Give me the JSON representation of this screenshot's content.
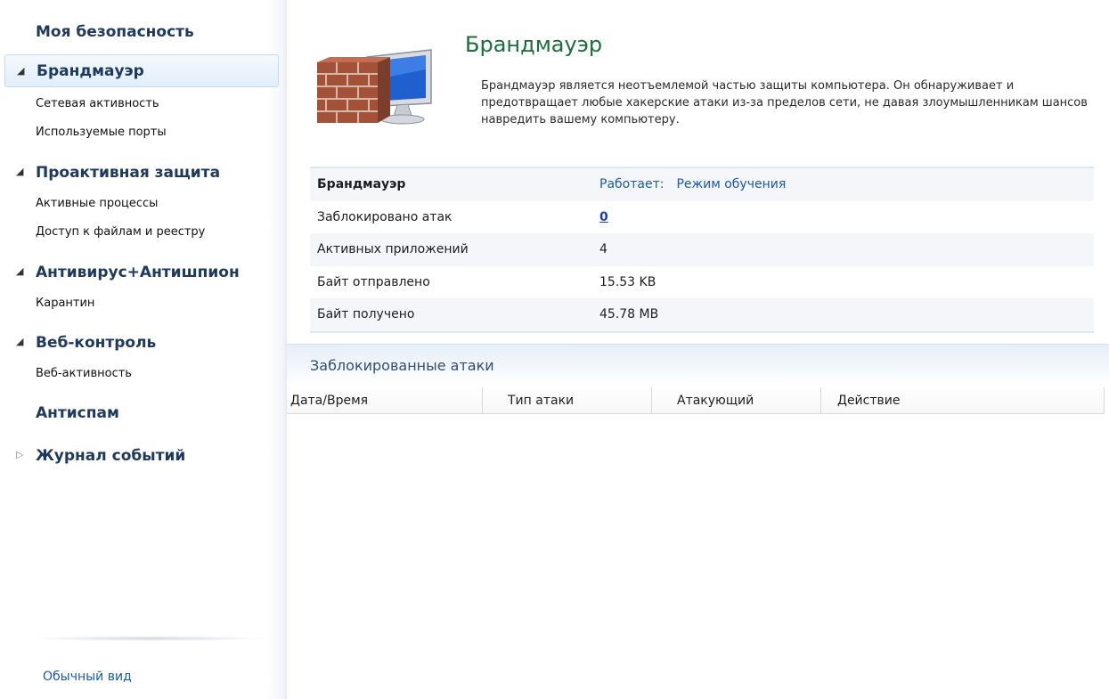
{
  "sidebar": {
    "title": "Моя безопасность",
    "groups": [
      {
        "label": "Брандмауэр",
        "expanded": true,
        "selected": true,
        "items": [
          "Сетевая активность",
          "Используемые порты"
        ]
      },
      {
        "label": "Проактивная защита",
        "expanded": true,
        "items": [
          "Активные процессы",
          "Доступ к файлам и реестру"
        ]
      },
      {
        "label": "Антивирус+Антишпион",
        "expanded": true,
        "items": [
          "Карантин"
        ]
      },
      {
        "label": "Веб-контроль",
        "expanded": true,
        "items": [
          "Веб-активность"
        ]
      },
      {
        "label": "Антиспам"
      },
      {
        "label": "Журнал событий",
        "expanded": false
      }
    ],
    "footer_link": "Обычный вид"
  },
  "main": {
    "title": "Брандмауэр",
    "description": "Брандмауэр является неотъемлемой частью защиты компьютера. Он обнаруживает и предотвращает любые хакерские атаки из-за пределов сети, не давая злоумышленникам шансов навредить вашему компьютеру.",
    "info": {
      "status_label": "Брандмауэр",
      "status_value": "Работает:",
      "status_mode": "Режим обучения",
      "blocked_label": "Заблокировано атак",
      "blocked_value": "0",
      "apps_label": "Активных приложений",
      "apps_value": "4",
      "sent_label": "Байт отправлено",
      "sent_value": "15.53 KB",
      "received_label": "Байт получено",
      "received_value": "45.78 MB"
    },
    "blocked_section": {
      "title": "Заблокированные атаки",
      "columns": [
        "Дата/Время",
        "Тип атаки",
        "Атакующий",
        "Действие"
      ]
    }
  },
  "colors": {
    "title_green": "#1b6e3a",
    "nav_blue": "#1f3a60",
    "link_blue": "#1a5aa8"
  }
}
